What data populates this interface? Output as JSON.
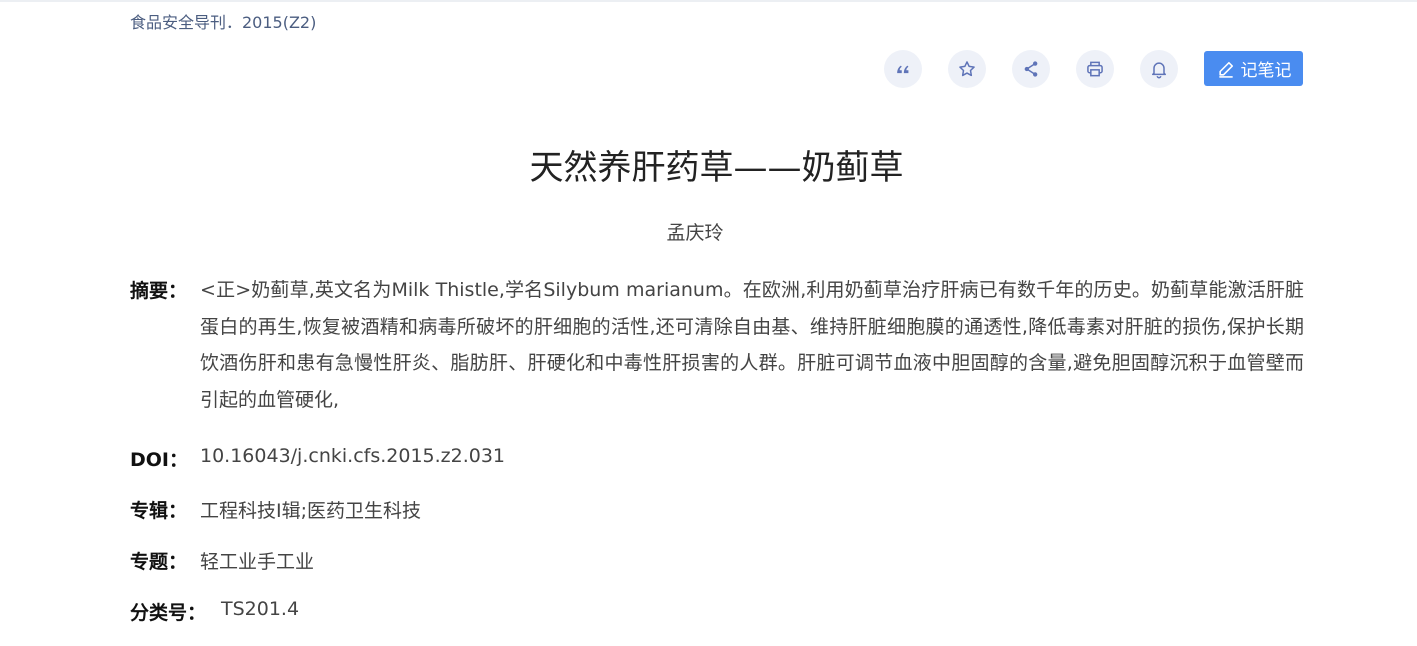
{
  "source": {
    "text": "食品安全导刊．2015(Z2)"
  },
  "toolbar": {
    "items": [
      {
        "name": "quote",
        "icon": "quote-icon"
      },
      {
        "name": "favorite",
        "icon": "star-icon"
      },
      {
        "name": "share",
        "icon": "share-icon"
      },
      {
        "name": "print",
        "icon": "printer-icon"
      },
      {
        "name": "notify",
        "icon": "bell-icon"
      }
    ],
    "note_label": "记笔记",
    "note_icon": "pencil-icon",
    "icon_color": "#5f74b8",
    "accent": "#4a8cf0"
  },
  "article": {
    "title": "天然养肝药草——奶蓟草",
    "author": "孟庆玲",
    "abstract_label": "摘要：",
    "abstract": "<正>奶蓟草,英文名为Milk Thistle,学名Silybum marianum。在欧洲,利用奶蓟草治疗肝病已有数千年的历史。奶蓟草能激活肝脏蛋白的再生,恢复被酒精和病毒所破坏的肝细胞的活性,还可清除自由基、维持肝脏细胞膜的通透性,降低毒素对肝脏的损伤,保护长期饮酒伤肝和患有急慢性肝炎、脂肪肝、肝硬化和中毒性肝损害的人群。肝脏可调节血液中胆固醇的含量,避免胆固醇沉积于血管壁而引起的血管硬化,",
    "doi_label": "DOI：",
    "doi": "10.16043/j.cnki.cfs.2015.z2.031",
    "series_label": "专辑：",
    "series": "工程科技Ⅰ辑;医药卫生科技",
    "subject_label": "专题：",
    "subject": "轻工业手工业",
    "class_label": "分类号：",
    "class_no": "TS201.4"
  }
}
